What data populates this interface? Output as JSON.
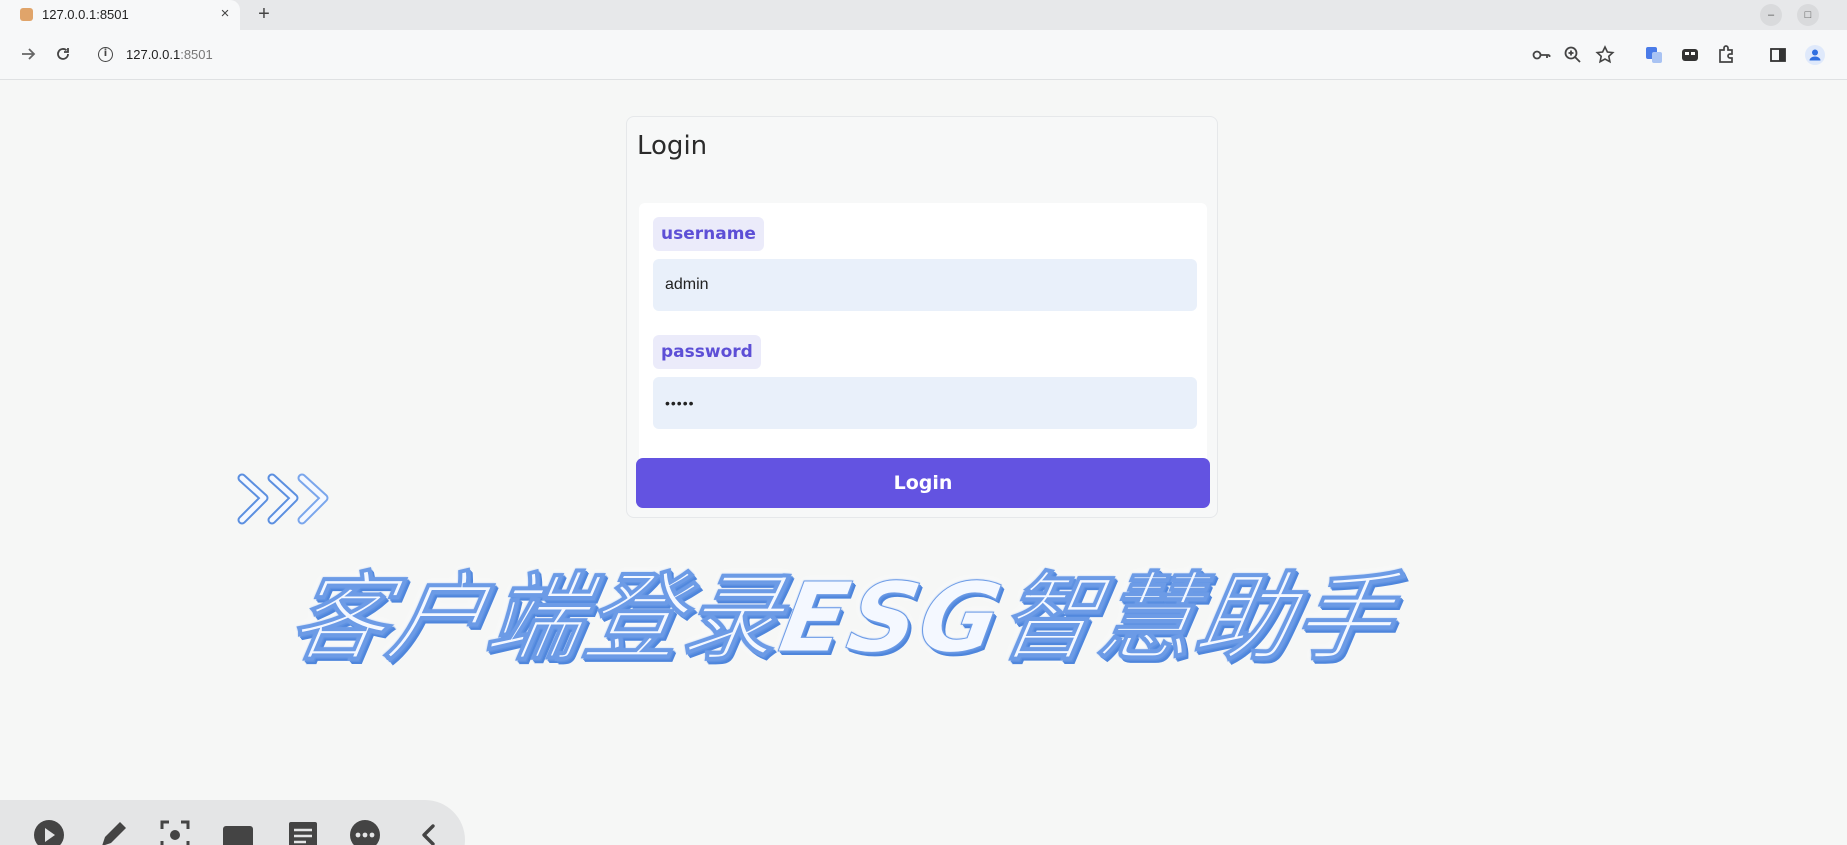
{
  "browser": {
    "tab_title": "127.0.0.1:8501",
    "tab_close": "×",
    "new_tab": "+",
    "window_buttons": [
      "–",
      "□"
    ],
    "url_host": "127.0.0.1",
    "url_port": ":8501",
    "info_icon_glyph": "i",
    "nav_icons": [
      "arrow-forward-icon",
      "reload-icon"
    ],
    "toolbar_icons": [
      "key-icon",
      "zoom-icon",
      "star-icon",
      "translate-icon",
      "media-icon",
      "extensions-icon",
      "side-panel-icon",
      "profile-icon"
    ]
  },
  "login": {
    "title": "Login",
    "username_label": "username",
    "username_value": "admin",
    "password_label": "password",
    "password_value": "•••••",
    "submit_label": "Login",
    "accent_color": "#6353e1"
  },
  "overlay": {
    "caption": "客户端登录ESG智慧助手"
  },
  "float_toolbar": {
    "icons": [
      "play-icon",
      "pen-icon",
      "screenshot-icon",
      "camera-icon",
      "notes-icon",
      "more-icon",
      "collapse-icon"
    ]
  }
}
